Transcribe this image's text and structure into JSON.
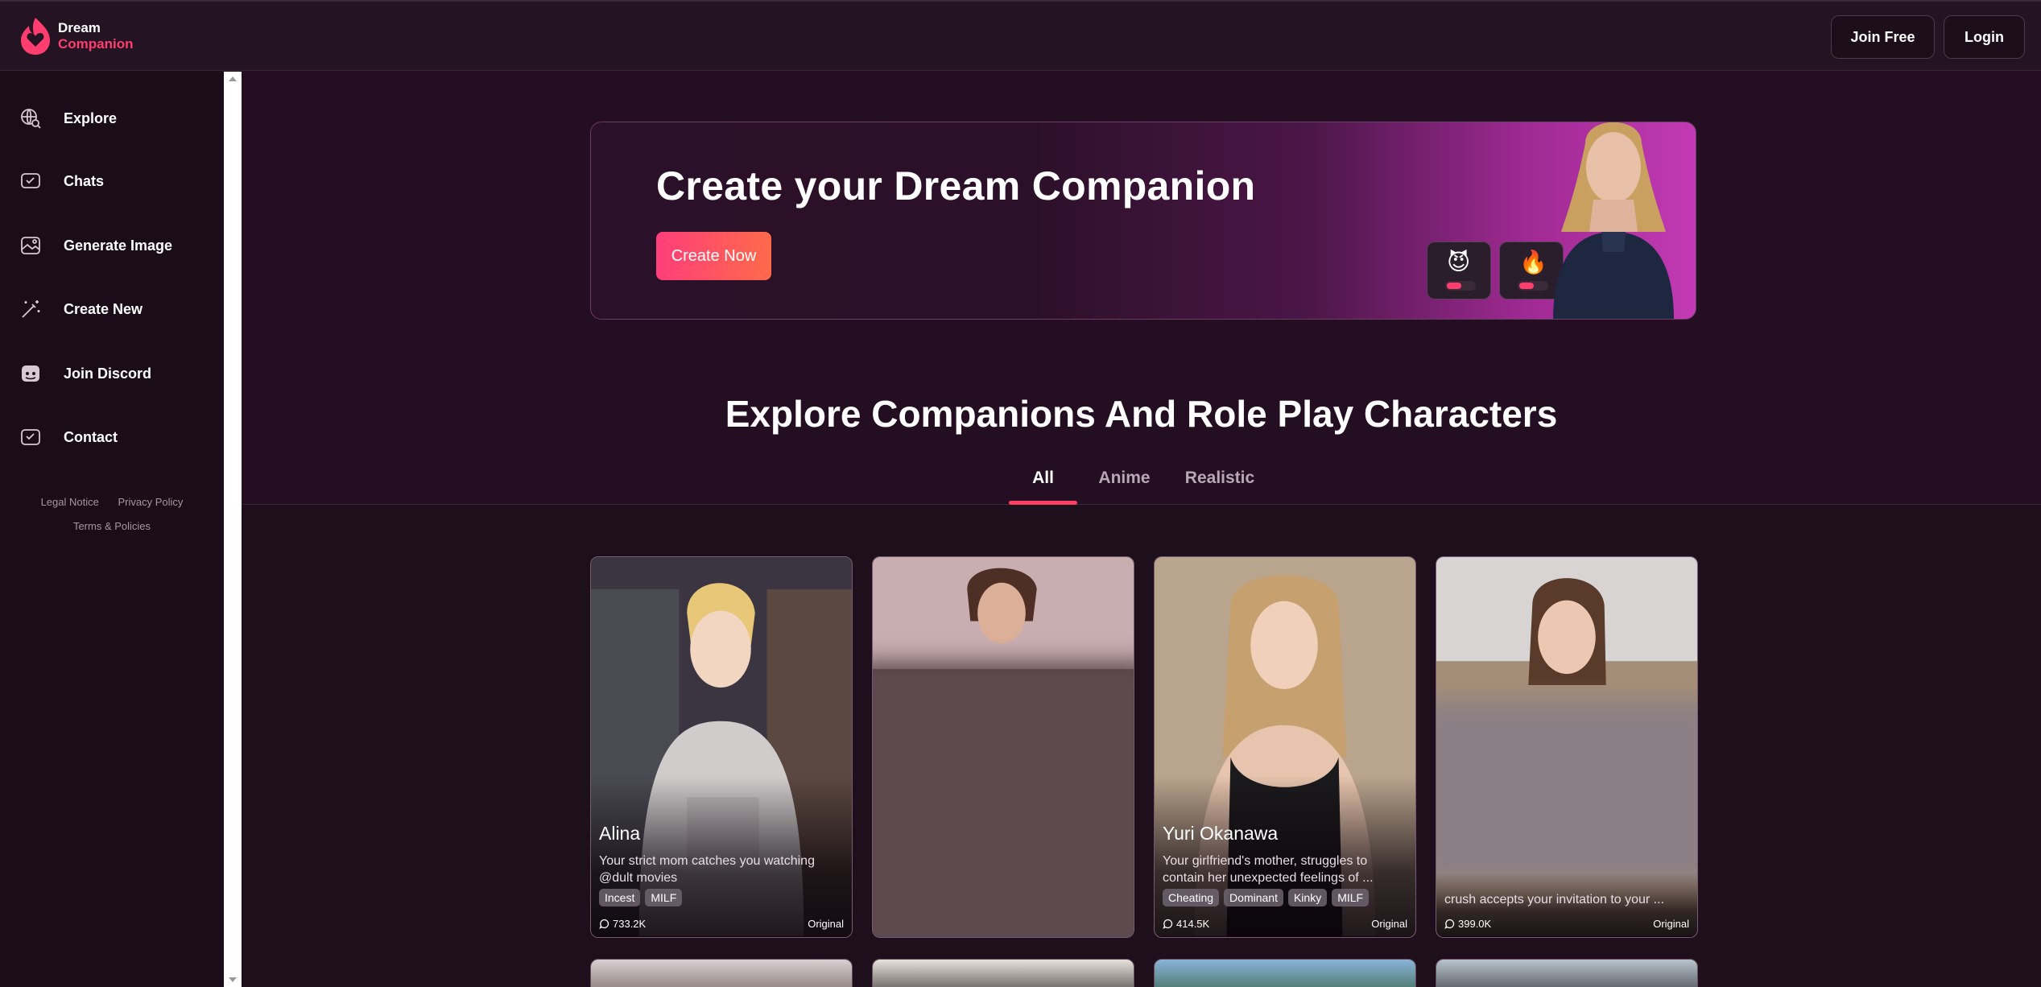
{
  "brand": {
    "line1": "Dream",
    "line2": "Companion"
  },
  "header": {
    "join_label": "Join Free",
    "login_label": "Login"
  },
  "sidebar": {
    "items": [
      {
        "label": "Explore",
        "icon": "globe-search-icon"
      },
      {
        "label": "Chats",
        "icon": "chat-icon"
      },
      {
        "label": "Generate Image",
        "icon": "image-icon"
      },
      {
        "label": "Create New",
        "icon": "wand-icon"
      },
      {
        "label": "Join Discord",
        "icon": "discord-icon"
      },
      {
        "label": "Contact",
        "icon": "mail-icon"
      }
    ],
    "footer": {
      "legal": "Legal Notice",
      "privacy": "Privacy Policy",
      "terms": "Terms & Policies"
    }
  },
  "banner": {
    "title": "Create your Dream Companion",
    "cta": "Create Now"
  },
  "explore": {
    "title": "Explore Companions And Role Play Characters",
    "tabs": [
      "All",
      "Anime",
      "Realistic"
    ],
    "active_tab": "All"
  },
  "cards": [
    {
      "name": "Alina",
      "desc": "Your strict mom catches you watching @dult movies",
      "tags": [
        "Incest",
        "MILF"
      ],
      "count": "733.2K",
      "badge": "Original"
    },
    {
      "name": "",
      "desc": "",
      "tags": [],
      "count": "",
      "badge": ""
    },
    {
      "name": "Yuri Okanawa",
      "desc": "Your girlfriend's mother, struggles to contain her unexpected feelings of ...",
      "tags": [
        "Cheating",
        "Dominant",
        "Kinky",
        "MILF"
      ],
      "count": "414.5K",
      "badge": "Original"
    },
    {
      "name": "",
      "desc": "crush accepts your invitation to your ...",
      "tags": [],
      "count": "399.0K",
      "badge": "Original"
    }
  ],
  "colors": {
    "accent": "#ff4062",
    "background": "#1e0f1d",
    "header": "#241423"
  }
}
